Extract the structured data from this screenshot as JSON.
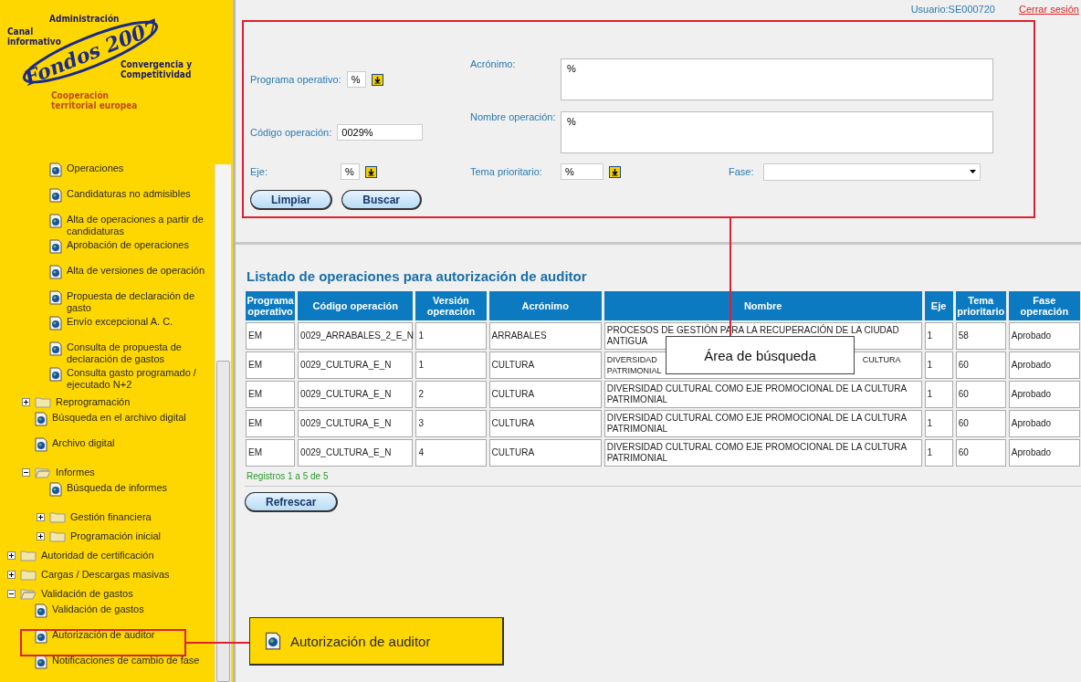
{
  "logo": {
    "top": "Administración",
    "left": "Canal informativo",
    "brand": "Fondos 2007",
    "right": "Convergencia y Competitividad",
    "bottom": "Cooperación territorial europea"
  },
  "tree": [
    {
      "children": [
        {
          "children": [
            {
              "kind": "page",
              "label": "Operaciones"
            },
            {
              "kind": "page",
              "label": "Candidaturas no admisibles"
            },
            {
              "kind": "page",
              "label": "Alta de operaciones a partir de candidaturas"
            },
            {
              "kind": "page",
              "label": "Aprobación de operaciones"
            },
            {
              "kind": "page",
              "label": "Alta de versiones de operación"
            },
            {
              "kind": "page",
              "label": "Propuesta de declaración de gasto"
            },
            {
              "kind": "page",
              "label": "Envío excepcional A. C."
            },
            {
              "kind": "page",
              "label": "Consulta de propuesta de declaración de gastos"
            },
            {
              "kind": "page",
              "label": "Consulta gasto programado / ejecutado N+2"
            }
          ]
        },
        {
          "kind": "folder",
          "label": "Reprogramación",
          "expanded": false
        },
        {
          "kind": "page",
          "label": "Búsqueda en el archivo digital"
        },
        {
          "kind": "page",
          "label": "Archivo digital"
        },
        {
          "kind": "folder",
          "label": "Informes",
          "expanded": true,
          "children": [
            {
              "kind": "page",
              "label": "Búsqueda de informes"
            },
            {
              "kind": "folder",
              "label": "Gestión financiera",
              "expanded": false
            },
            {
              "kind": "folder",
              "label": "Programación inicial",
              "expanded": false
            }
          ]
        }
      ]
    },
    {
      "kind": "folder",
      "label": "Autoridad de certificación",
      "expanded": false
    },
    {
      "kind": "folder",
      "label": "Cargas / Descargas masivas",
      "expanded": false
    },
    {
      "kind": "folder",
      "label": "Validación de gastos",
      "expanded": true,
      "children": [
        {
          "kind": "page",
          "label": "Validación de gastos"
        },
        {
          "kind": "page",
          "label": "Autorización de auditor"
        },
        {
          "kind": "page",
          "label": "Notificaciones de cambio de fase"
        }
      ]
    }
  ],
  "user": {
    "label": "Usuario:SE000720",
    "logout": "Cerrar sesión"
  },
  "search": {
    "programa": {
      "label": "Programa operativo:",
      "value": "%"
    },
    "codigo": {
      "label": "Código operación:",
      "value": "0029%"
    },
    "eje": {
      "label": "Eje:",
      "value": "%"
    },
    "acronimo": {
      "label": "Acrónimo:",
      "value": "%"
    },
    "nombre": {
      "label": "Nombre operación:",
      "value": "%"
    },
    "tema": {
      "label": "Tema prioritario:",
      "value": "%"
    },
    "fase": {
      "label": "Fase:"
    },
    "buttons": [
      "Limpiar",
      "Buscar"
    ]
  },
  "listing": {
    "title": "Listado de operaciones para autorización de auditor",
    "columns": [
      "Programa operativo",
      "Código operación",
      "Versión operación",
      "Acrónimo",
      "Nombre",
      "Eje",
      "Tema prioritario",
      "Fase operación"
    ],
    "rows": [
      [
        "EM",
        "0029_ARRABALES_2_E_N",
        "1",
        "ARRABALES",
        "PROCESOS DE GESTIÓN PARA LA RECUPERACIÓN DE LA CIUDAD ANTIGUA",
        "1",
        "58",
        "Aprobado"
      ],
      [
        "EM",
        "0029_CULTURA_E_N",
        "1",
        "CULTURA",
        [
          "DIVERSIDAD",
          "CULTURA",
          "PATRIMONIAL"
        ],
        "1",
        "60",
        "Aprobado"
      ],
      [
        "EM",
        "0029_CULTURA_E_N",
        "2",
        "CULTURA",
        "DIVERSIDAD CULTURAL COMO EJE PROMOCIONAL DE LA CULTURA PATRIMONIAL",
        "1",
        "60",
        "Aprobado"
      ],
      [
        "EM",
        "0029_CULTURA_E_N",
        "3",
        "CULTURA",
        "DIVERSIDAD CULTURAL COMO EJE PROMOCIONAL DE LA CULTURA PATRIMONIAL",
        "1",
        "60",
        "Aprobado"
      ],
      [
        "EM",
        "0029_CULTURA_E_N",
        "4",
        "CULTURA",
        "DIVERSIDAD CULTURAL COMO EJE PROMOCIONAL DE LA CULTURA PATRIMONIAL",
        "1",
        "60",
        "Aprobado"
      ]
    ],
    "count": "Registros 1 a 5 de 5",
    "refresh": "Refrescar"
  },
  "callouts": {
    "search_area": "Área de búsqueda",
    "menu_item": "Autorización de auditor"
  }
}
